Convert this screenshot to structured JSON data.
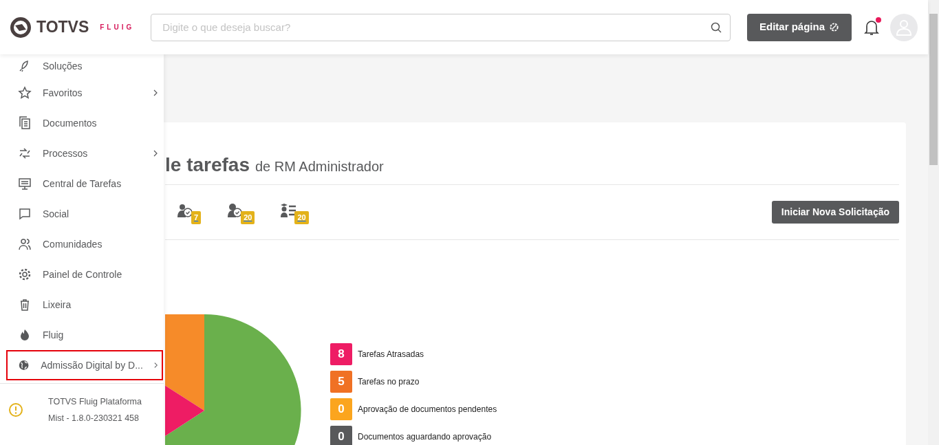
{
  "header": {
    "logo_text": "TOTVS",
    "logo_sub": "FLUIG",
    "search": {
      "placeholder": "Digite o que deseja buscar?"
    },
    "edit_button": "Editar página",
    "notification_dot": true
  },
  "sidebar": {
    "items": [
      {
        "label": "Soluções",
        "submenu": false,
        "highlighted": false
      },
      {
        "label": "Favoritos",
        "submenu": true,
        "highlighted": false
      },
      {
        "label": "Documentos",
        "submenu": false,
        "highlighted": false
      },
      {
        "label": "Processos",
        "submenu": true,
        "highlighted": false
      },
      {
        "label": "Central de Tarefas",
        "submenu": false,
        "highlighted": false
      },
      {
        "label": "Social",
        "submenu": false,
        "highlighted": false
      },
      {
        "label": "Comunidades",
        "submenu": false,
        "highlighted": false
      },
      {
        "label": "Painel de Controle",
        "submenu": false,
        "highlighted": false
      },
      {
        "label": "Lixeira",
        "submenu": false,
        "highlighted": false
      },
      {
        "label": "Fluig",
        "submenu": false,
        "highlighted": false
      },
      {
        "label": "Admissão Digital by D...",
        "submenu": true,
        "highlighted": true
      }
    ],
    "footer": [
      "TOTVS Fluig Plataforma",
      "Mist - 1.8.0-230321 458"
    ]
  },
  "card": {
    "title": "le tarefas",
    "subtitle": "de RM Administrador",
    "task_tabs": [
      {
        "badge": "7"
      },
      {
        "badge": "20"
      },
      {
        "badge": "20"
      }
    ],
    "new_request_button": "Iniciar Nova Solicitação",
    "legend": [
      {
        "count": "8",
        "label": "Tarefas Atrasadas",
        "color": "#ee1c64"
      },
      {
        "count": "5",
        "label": "Tarefas no prazo",
        "color": "#f07124"
      },
      {
        "count": "0",
        "label": "Aprovação de documentos pendentes",
        "color": "#fba51e"
      },
      {
        "count": "0",
        "label": "Documentos aguardando aprovação",
        "color": "#58595b"
      }
    ]
  }
}
